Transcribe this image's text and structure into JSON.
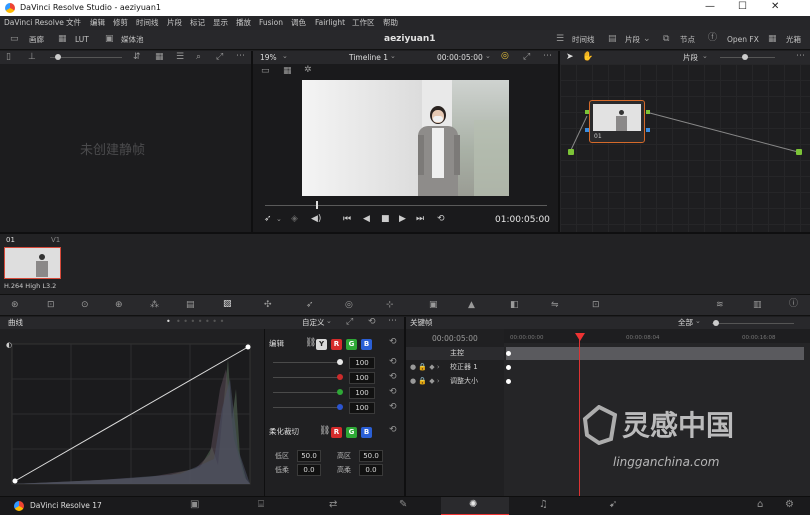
{
  "window": {
    "title": "DaVinci Resolve Studio - aeziyuan1",
    "controls": [
      "—",
      "☐",
      "✕"
    ]
  },
  "menu": [
    "DaVinci Resolve",
    "文件",
    "编辑",
    "修剪",
    "时间线",
    "片段",
    "标记",
    "显示",
    "播放",
    "Fusion",
    "调色",
    "Fairlight",
    "工作区",
    "帮助"
  ],
  "toolbar": {
    "gallery": "画廊",
    "lut": "LUT",
    "media_pool": "媒体池",
    "project_name": "aeziyuan1",
    "timeline": "时间线",
    "clips": "片段",
    "nodes": "节点",
    "openfx": "Open FX",
    "lightbox": "光箱"
  },
  "viewer": {
    "zoom": "19%",
    "timeline_name": "Timeline 1",
    "timecode_top": "00:00:05:00",
    "timecode": "01:00:05:00",
    "playhead": 0.18
  },
  "gallery": {
    "empty_text": "未创建静帧"
  },
  "node_panel": {
    "mode": "片段",
    "node_label": "01"
  },
  "clips": [
    {
      "index": "01",
      "track": "V1",
      "codec": "H.264 High L3.2"
    }
  ],
  "curves": {
    "title": "曲线",
    "preset": "自定义",
    "edit_label": "编辑",
    "channel_chips": [
      "Y",
      "R",
      "G",
      "B"
    ],
    "chip_colors": [
      "#d9d9d9",
      "#d52b2b",
      "#2ea836",
      "#2a5fd6"
    ],
    "sliders": [
      {
        "color": "#e8e8e8",
        "value": "100"
      },
      {
        "color": "#cc2b2b",
        "value": "100"
      },
      {
        "color": "#2ea836",
        "value": "100"
      },
      {
        "color": "#2b54d0",
        "value": "100"
      }
    ],
    "soft_clip_label": "柔化裁切",
    "soft_chips": [
      "R",
      "G",
      "B"
    ],
    "low_label": "低区",
    "low_value": "50.0",
    "high_label": "高区",
    "high_value": "50.0",
    "low_soft_label": "低柔",
    "low_soft_value": "0.0",
    "high_soft_label": "高柔",
    "high_soft_value": "0.0"
  },
  "keyframes": {
    "title": "关键帧",
    "filter": "全部",
    "timecode": "00:00:05:00",
    "ruler": [
      "00:00:00:00",
      "00:00:08:04",
      "00:00:16:08"
    ],
    "tracks": [
      "主控",
      "校正器 1",
      "调整大小"
    ],
    "playhead": 0.245
  },
  "footer": {
    "app_name": "DaVinci Resolve 17",
    "active_page": "color"
  },
  "watermark": {
    "brand": "灵感中国",
    "url": "lingganchina.com"
  }
}
